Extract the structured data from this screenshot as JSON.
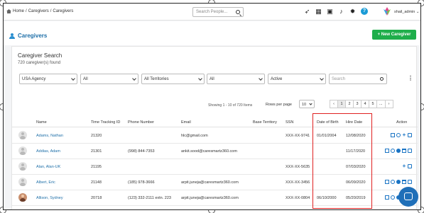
{
  "breadcrumb": {
    "home": "Home",
    "sep1": "/",
    "level1": "Caregivers",
    "sep2": "/",
    "level2": "Caregivers"
  },
  "topbar": {
    "search_placeholder": "Search People...",
    "icons": [
      "rocket-icon",
      "calendar-icon",
      "contact-card-icon",
      "bell-icon",
      "gear-icon",
      "help-icon"
    ],
    "help_label": "?",
    "user": "shail_admin ⌄"
  },
  "page": {
    "title": "Caregivers",
    "new_button": "+ New Caregiver"
  },
  "search": {
    "title": "Caregiver Search",
    "count": "720 caregiver(s) found",
    "filters": [
      "USA Agency",
      "All",
      "All Territories",
      "All",
      "Active"
    ],
    "search_placeholder": "Search",
    "menu": "⋮"
  },
  "pagination": {
    "showing": "Showing 1 - 10 of 720 Items",
    "rows_label": "Rows per page",
    "rows_value": "10",
    "pages": [
      "‹",
      "1",
      "2",
      "3",
      "4",
      "5",
      "...",
      "›"
    ],
    "active": "1"
  },
  "columns": [
    "Name",
    "Time Tracking ID",
    "Phone Number",
    "Email",
    "Base Territory",
    "SSN",
    "Date of Birth",
    "Hire Date",
    "Action"
  ],
  "rows": [
    {
      "name": "Adams, Nathan",
      "ttid": "21320",
      "phone": "",
      "email": "hlc@gmail.com",
      "ssn": "XXX-XX-9741",
      "dob": "01/01/2004",
      "hire": "12/08/2020",
      "photo": false,
      "actions": [
        "mail-icon",
        "key-icon",
        "add-icon",
        "edit-icon"
      ]
    },
    {
      "name": "Addias, Adam",
      "ttid": "21301",
      "phone": "(998) 844-7353",
      "email": "ankit.sood@caresmartz360.com",
      "ssn": "",
      "dob": "",
      "hire": "11/17/2020",
      "photo": false,
      "actions": [
        "mail-icon",
        "key-icon",
        "chat-icon",
        "calendar-icon",
        "edit-icon"
      ]
    },
    {
      "name": "Alan, Alan-UK",
      "ttid": "21195",
      "phone": "",
      "email": "",
      "ssn": "XXX-XX-5635",
      "dob": "",
      "hire": "07/03/2020",
      "photo": false,
      "actions": [
        "add-icon",
        "edit-icon"
      ]
    },
    {
      "name": "Albert, Eric",
      "ttid": "21148",
      "phone": "(185) 978-3666",
      "email": "arpit.juneja@caresmartz360.com",
      "ssn": "XXX-XX-3456",
      "dob": "",
      "hire": "06/09/2020",
      "photo": false,
      "actions": [
        "mail-icon",
        "key-icon",
        "chat-icon",
        "calendar-icon",
        "edit-icon"
      ]
    },
    {
      "name": "Allison, Sydney",
      "ttid": "20718",
      "phone": "(123) 332-2111 extn. 223",
      "email": "arpit.juneja@caresmartz360.com",
      "ssn": "XXX-XX-0804",
      "dob": "06/10/2000",
      "hire": "05/20/2019",
      "photo": true,
      "actions": [
        "mail-icon",
        "key-icon",
        "chat-icon",
        "calendar-icon",
        "edit-icon"
      ]
    }
  ],
  "colors": {
    "accent": "#1e6fa8",
    "new_button": "#1fae4b",
    "highlight": "#e02020",
    "chat_button": "#1f6fb8"
  }
}
